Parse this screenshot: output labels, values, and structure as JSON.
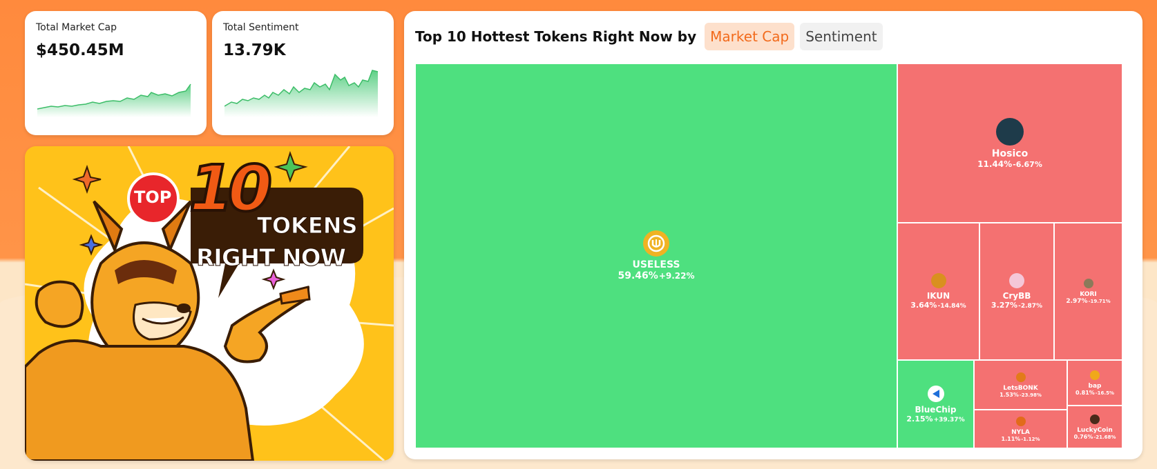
{
  "stats": [
    {
      "label": "Total Market Cap",
      "value": "$450.45M"
    },
    {
      "label": "Total Sentiment",
      "value": "13.79K"
    }
  ],
  "banner": {
    "badge": "TOP",
    "number": "10",
    "line1": "TOKENS",
    "line2": "RIGHT NOW"
  },
  "treemap_panel": {
    "title": "Top 10 Hottest Tokens Right Now by",
    "tabs": [
      {
        "label": "Market Cap",
        "active": true
      },
      {
        "label": "Sentiment",
        "active": false
      }
    ]
  },
  "colors": {
    "up": "#4ee07f",
    "down": "#f47171",
    "accent": "#f26a1b"
  },
  "tokens": [
    {
      "name": "USELESS",
      "share": "59.46%",
      "change": "+9.22%",
      "trend": "up",
      "icon": "useless-logo-icon"
    },
    {
      "name": "Hosico",
      "share": "11.44%",
      "change": "-6.67%",
      "trend": "down",
      "icon": "cat-avatar-icon"
    },
    {
      "name": "IKUN",
      "share": "3.64%",
      "change": "-14.84%",
      "trend": "down",
      "icon": "ikun-avatar-icon"
    },
    {
      "name": "CryBB",
      "share": "3.27%",
      "change": "-2.87%",
      "trend": "down",
      "icon": "crybb-avatar-icon"
    },
    {
      "name": "KORI",
      "share": "2.97%",
      "change": "-19.71%",
      "trend": "down",
      "icon": "kori-avatar-icon"
    },
    {
      "name": "BlueChip",
      "share": "2.15%",
      "change": "+39.37%",
      "trend": "up",
      "icon": "bluechip-logo-icon"
    },
    {
      "name": "LetsBONK",
      "share": "1.53%",
      "change": "-23.98%",
      "trend": "down",
      "icon": "letsbonk-avatar-icon"
    },
    {
      "name": "NYLA",
      "share": "1.11%",
      "change": "-1.12%",
      "trend": "down",
      "icon": "nyla-avatar-icon"
    },
    {
      "name": "bap",
      "share": "0.81%",
      "change": "-16.5%",
      "trend": "down",
      "icon": "bap-avatar-icon"
    },
    {
      "name": "LuckyCoin",
      "share": "0.76%",
      "change": "-21.68%",
      "trend": "down",
      "icon": "luckycoin-avatar-icon"
    }
  ]
}
